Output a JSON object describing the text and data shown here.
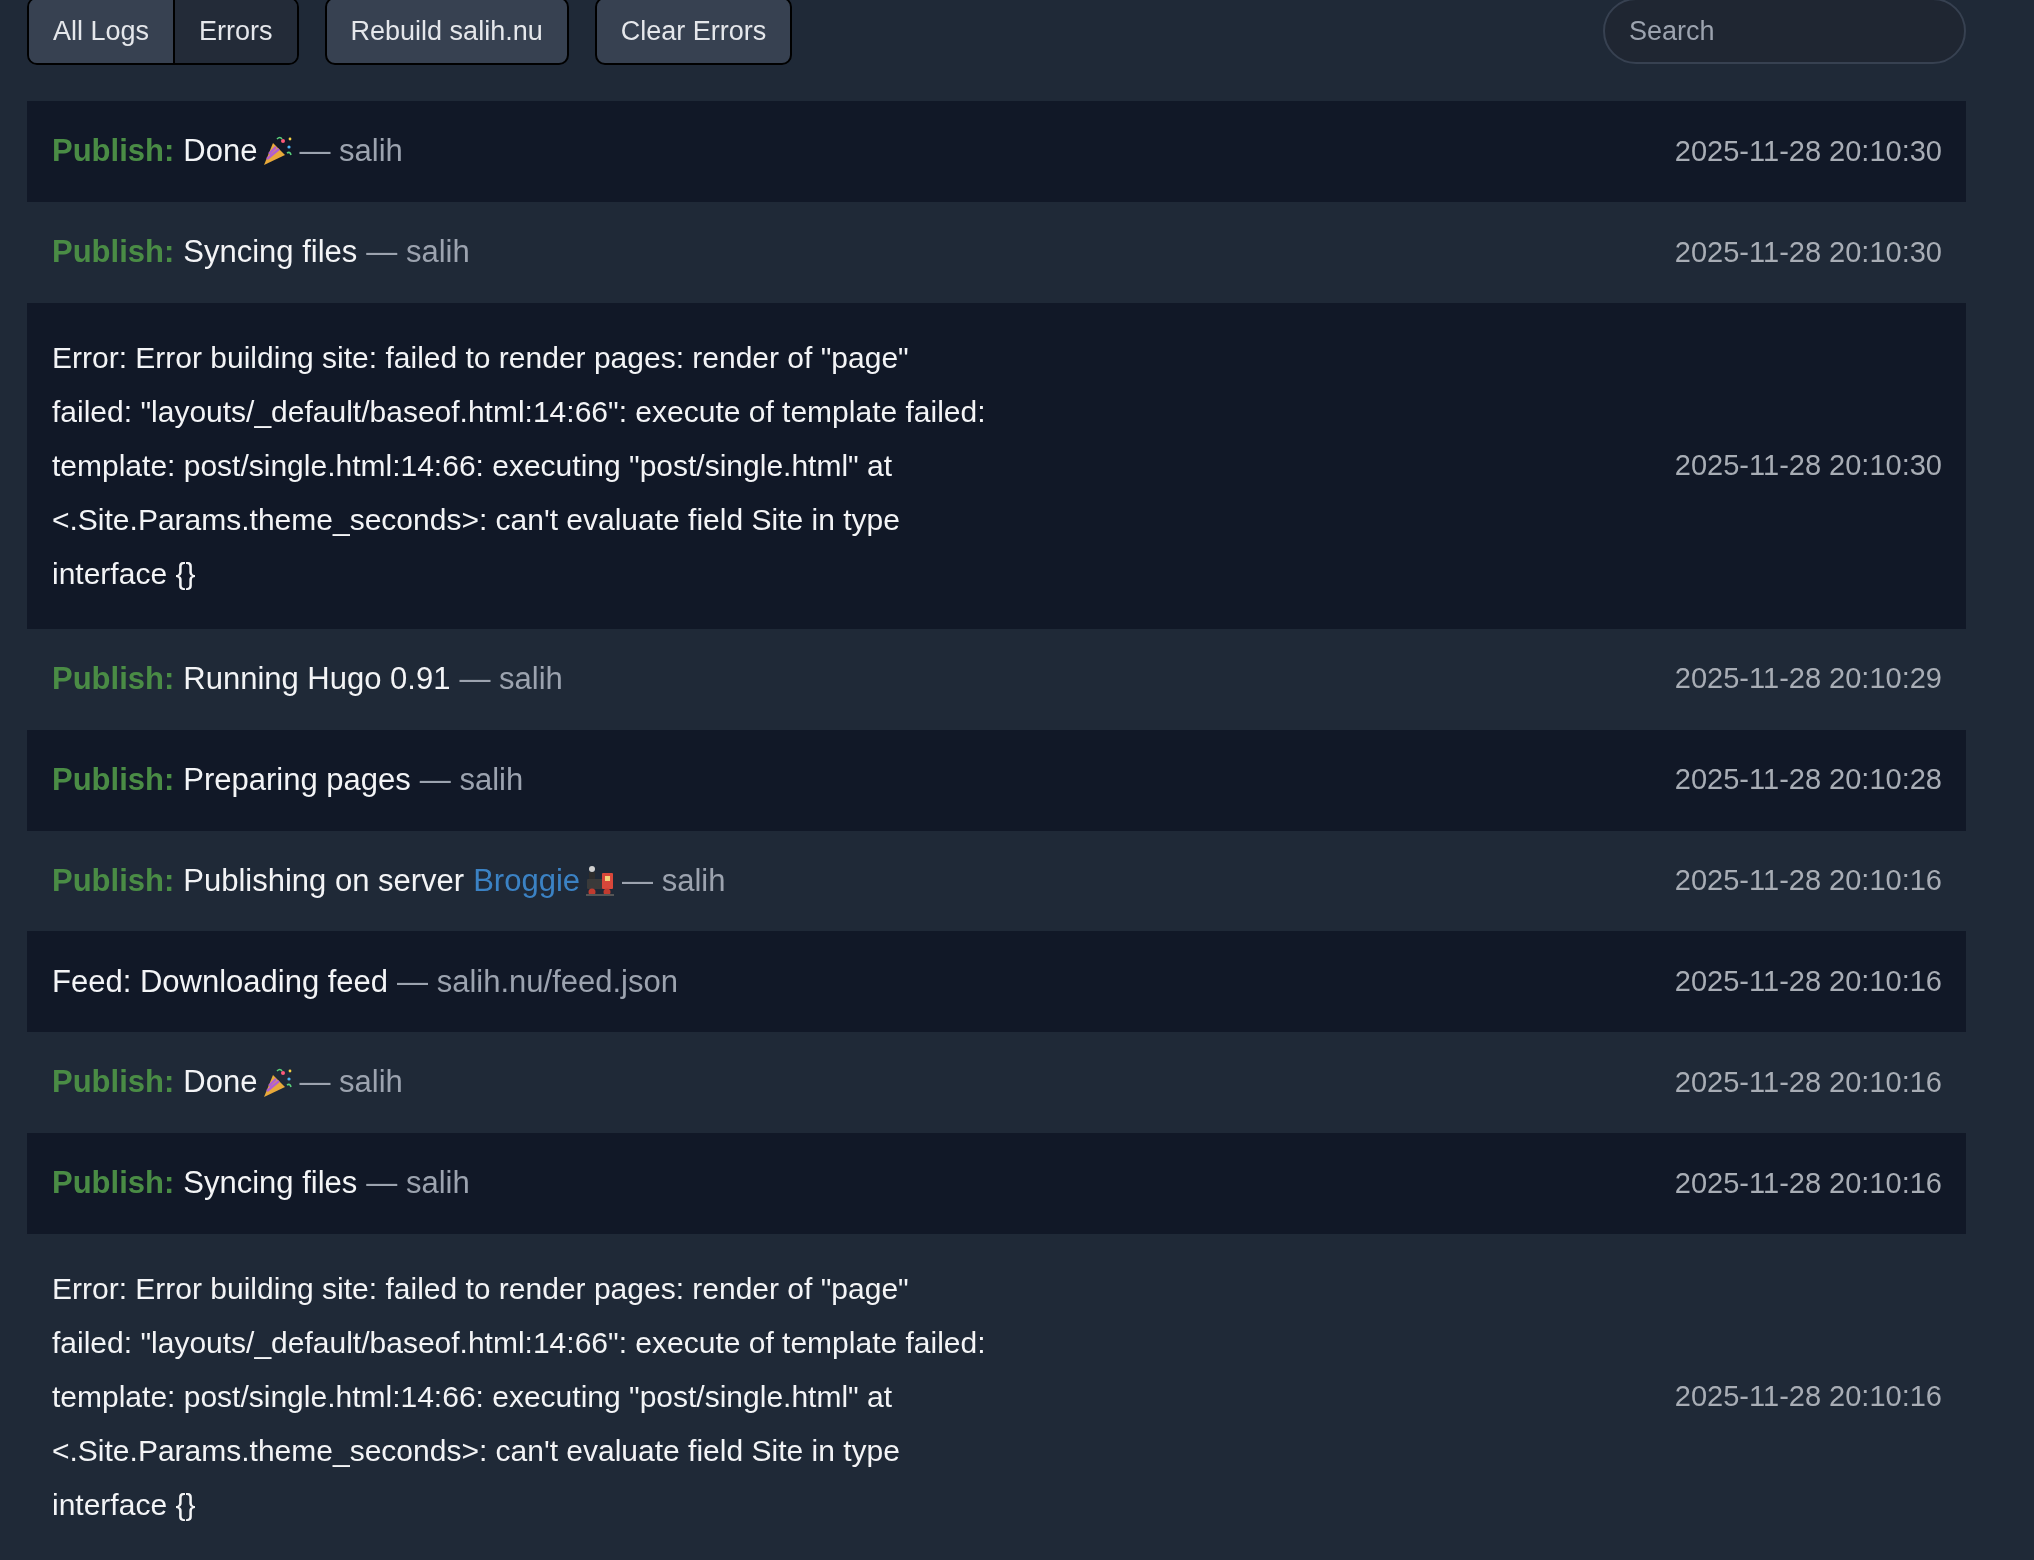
{
  "filters": [
    {
      "label": "All Logs",
      "selected": true
    },
    {
      "label": "Errors",
      "selected": false
    }
  ],
  "actions": [
    "Rebuild salih.nu",
    "Clear Errors"
  ],
  "search": {
    "placeholder": "Search"
  },
  "logs": [
    {
      "kind": "done",
      "label": "Publish:",
      "message": "Done",
      "suffix": "— salih",
      "time": "2025-11-28 20:10:30"
    },
    {
      "kind": "publish",
      "label": "Publish:",
      "message": "Syncing files",
      "suffix": "— salih",
      "time": "2025-11-28 20:10:30"
    },
    {
      "kind": "error",
      "message": "Error: Error building site: failed to render pages: render of \"page\" failed: \"layouts/_default/baseof.html:14:66\": execute of template failed: template: post/single.html:14:66: executing \"post/single.html\" at <.Site.Params.theme_seconds>: can't evaluate field Site in type interface {}",
      "time": "2025-11-28 20:10:30"
    },
    {
      "kind": "publish",
      "label": "Publish:",
      "message": "Running Hugo 0.91",
      "suffix": "— salih",
      "time": "2025-11-28 20:10:29"
    },
    {
      "kind": "publish",
      "label": "Publish:",
      "message": "Preparing pages",
      "suffix": "— salih",
      "time": "2025-11-28 20:10:28"
    },
    {
      "kind": "server",
      "label": "Publish:",
      "message": "Publishing on server",
      "link": "Broggie",
      "suffix": "— salih",
      "time": "2025-11-28 20:10:16"
    },
    {
      "kind": "feed",
      "message": "Feed: Downloading feed",
      "suffix": "— salih.nu/feed.json",
      "time": "2025-11-28 20:10:16"
    },
    {
      "kind": "done",
      "label": "Publish:",
      "message": "Done",
      "suffix": "— salih",
      "time": "2025-11-28 20:10:16"
    },
    {
      "kind": "publish",
      "label": "Publish:",
      "message": "Syncing files",
      "suffix": "— salih",
      "time": "2025-11-28 20:10:16"
    },
    {
      "kind": "error",
      "message": "Error: Error building site: failed to render pages: render of \"page\" failed: \"layouts/_default/baseof.html:14:66\": execute of template failed: template: post/single.html:14:66: executing \"post/single.html\" at <.Site.Params.theme_seconds>: can't evaluate field Site in type interface {}",
      "time": "2025-11-28 20:10:16"
    }
  ]
}
